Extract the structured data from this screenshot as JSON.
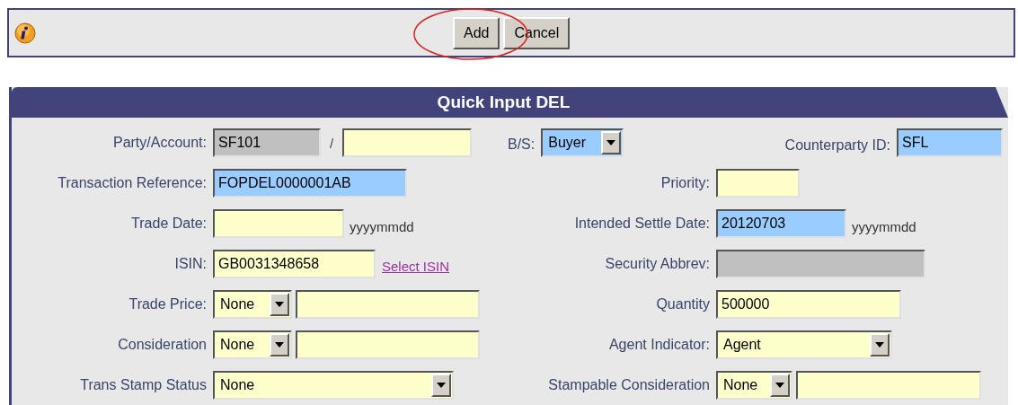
{
  "toolbar": {
    "buttons": [
      {
        "label": "Add",
        "circled": true
      },
      {
        "label": "Cancel",
        "circled": false
      }
    ]
  },
  "panel": {
    "title": "Quick Input DEL"
  },
  "rows": [
    {
      "left": {
        "label": "Party/Account:",
        "controls": [
          {
            "kind": "text",
            "value": "SF101",
            "disabled": true
          },
          {
            "kind": "separator",
            "text": "/"
          },
          {
            "kind": "text",
            "highlighted": false,
            "disabled": false
          }
        ]
      },
      "middle": {
        "label": "B/S:",
        "controls": [
          {
            "kind": "select",
            "value": "Buyer",
            "highlighted": true
          }
        ]
      },
      "right": {
        "label": "Counterparty ID:",
        "controls": [
          {
            "kind": "text",
            "value": "SFL",
            "highlighted": true,
            "disabled": false
          }
        ]
      }
    },
    {
      "left": {
        "label": "Transaction Reference:",
        "controls": [
          {
            "kind": "text",
            "value": "FOPDEL0000001AB",
            "highlighted": true,
            "disabled": false
          }
        ]
      },
      "right": {
        "label": "Priority:",
        "controls": [
          {
            "kind": "text",
            "highlighted": false,
            "disabled": false
          }
        ]
      }
    },
    {
      "left": {
        "label": "Trade Date:",
        "controls": [
          {
            "kind": "text",
            "highlighted": false,
            "disabled": false
          },
          {
            "kind": "note",
            "text": "yyyymmdd"
          }
        ]
      },
      "right": {
        "label": "Intended Settle Date:",
        "controls": [
          {
            "kind": "text",
            "value": "20120703",
            "highlighted": true,
            "disabled": false
          },
          {
            "kind": "note",
            "text": "yyyymmdd"
          }
        ]
      }
    },
    {
      "left": {
        "label": "ISIN:",
        "controls": [
          {
            "kind": "text",
            "value": "GB0031348658",
            "highlighted": false,
            "disabled": false
          },
          {
            "kind": "link",
            "text": "Select ISIN"
          }
        ]
      },
      "right": {
        "label": "Security Abbrev:",
        "controls": [
          {
            "kind": "text",
            "disabled": true
          }
        ]
      }
    },
    {
      "left": {
        "label": "Trade Price:",
        "controls": [
          {
            "kind": "select",
            "value": "None",
            "highlighted": false
          },
          {
            "kind": "text",
            "highlighted": false,
            "disabled": false
          }
        ]
      },
      "right": {
        "label": "Quantity",
        "controls": [
          {
            "kind": "text",
            "value": "500000",
            "highlighted": false,
            "disabled": false
          }
        ]
      }
    },
    {
      "left": {
        "label": "Consideration",
        "controls": [
          {
            "kind": "select",
            "value": "None",
            "highlighted": false
          },
          {
            "kind": "text",
            "highlighted": false,
            "disabled": false
          }
        ]
      },
      "right": {
        "label": "Agent Indicator:",
        "controls": [
          {
            "kind": "select",
            "value": "Agent",
            "highlighted": false
          }
        ]
      }
    },
    {
      "left": {
        "label": "Trans Stamp Status",
        "controls": [
          {
            "kind": "select",
            "value": "None",
            "highlighted": false
          }
        ]
      },
      "right": {
        "label": "Stampable Consideration",
        "controls": [
          {
            "kind": "select",
            "value": "None",
            "highlighted": false
          },
          {
            "kind": "text",
            "highlighted": false,
            "disabled": false
          }
        ]
      }
    }
  ]
}
